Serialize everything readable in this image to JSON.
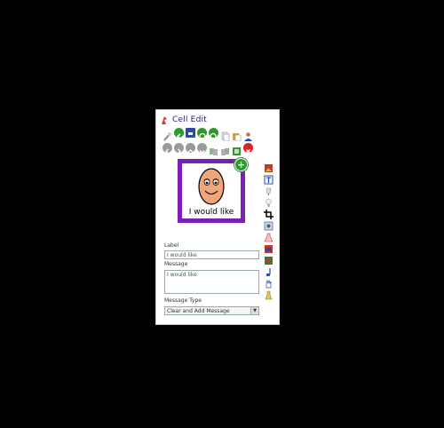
{
  "window": {
    "title": "Cell Edit"
  },
  "toolbar_row1": [
    "wand-icon",
    "back-icon",
    "save-icon",
    "refresh-icon",
    "redo-icon",
    "copy-icon",
    "paste-icon",
    "user-icon"
  ],
  "toolbar_row2": [
    "nav-left-icon",
    "nav-right-icon",
    "nav-up-icon",
    "nav-down-icon",
    "move-icon",
    "move-alt-icon",
    "arrange-icon",
    "close-icon"
  ],
  "cell": {
    "label_text": "I would like"
  },
  "side_tools": [
    "picture-icon",
    "text-icon",
    "fill-icon",
    "bulb-icon",
    "crop-icon",
    "image-settings-icon",
    "flask-icon",
    "style-icon",
    "colors-icon",
    "sound-icon",
    "hand-icon",
    "action-icon"
  ],
  "form": {
    "label_caption": "Label",
    "label_value": "I would like",
    "message_caption": "Message",
    "message_value": "I would like",
    "message_type_caption": "Message Type",
    "message_type_value": "Clear and Add Message"
  }
}
